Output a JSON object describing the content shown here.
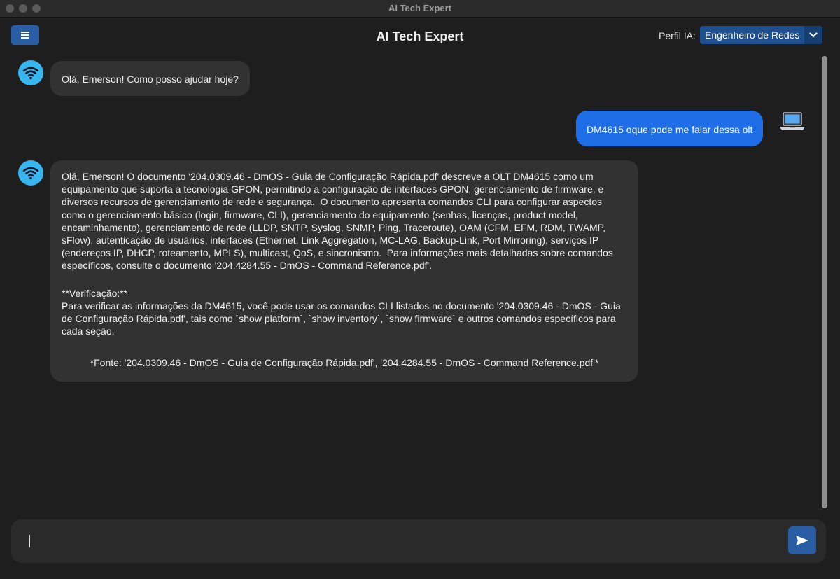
{
  "window": {
    "title": "AI Tech Expert"
  },
  "header": {
    "title": "AI Tech Expert",
    "profile_label": "Perfil IA:",
    "profile_value": "Engenheiro de Redes"
  },
  "messages": [
    {
      "role": "bot",
      "text": "Olá, Emerson! Como posso ajudar hoje?"
    },
    {
      "role": "user",
      "text": "DM4615 oque pode me falar dessa olt"
    },
    {
      "role": "bot",
      "paragraph1": "Olá, Emerson! O documento '204.0309.46 - DmOS - Guia de Configuração Rápida.pdf' descreve a OLT DM4615 como um equipamento que suporta a tecnologia GPON, permitindo a configuração de interfaces GPON, gerenciamento de firmware, e diversos recursos de gerenciamento de rede e segurança.  O documento apresenta comandos CLI para configurar aspectos como o gerenciamento básico (login, firmware, CLI), gerenciamento do equipamento (senhas, licenças, product model, encaminhamento), gerenciamento de rede (LLDP, SNTP, Syslog, SNMP, Ping, Traceroute), OAM (CFM, EFM, RDM, TWAMP, sFlow), autenticação de usuários, interfaces (Ethernet, Link Aggregation, MC-LAG, Backup-Link, Port Mirroring), serviços IP (endereços IP, DHCP, roteamento, MPLS), multicast, QoS, e sincronismo.  Para informações mais detalhadas sobre comandos específicos, consulte o documento '204.4284.55 - DmOS - Command Reference.pdf'.",
      "verification_heading": "**Verificação:**",
      "verification_text": "Para verificar as informações da DM4615, você pode usar os comandos CLI listados no documento '204.0309.46 - DmOS - Guia de Configuração Rápida.pdf', tais como `show platform`, `show inventory`, `show firmware` e outros comandos específicos para cada seção.",
      "source": "*Fonte: '204.0309.46 - DmOS - Guia de Configuração Rápida.pdf', '204.4284.55 - DmOS - Command Reference.pdf'*"
    }
  ],
  "input": {
    "value": ""
  },
  "icons": {
    "menu": "menu-icon",
    "chevron": "chevron-down-icon",
    "bot_avatar": "wifi-icon",
    "user_avatar": "laptop-icon",
    "send": "send-icon"
  },
  "colors": {
    "background": "#1e1e1e",
    "bot_bubble": "#323232",
    "user_bubble": "#1f6ee8",
    "accent": "#2a5ea4",
    "avatar": "#38b6f0"
  }
}
